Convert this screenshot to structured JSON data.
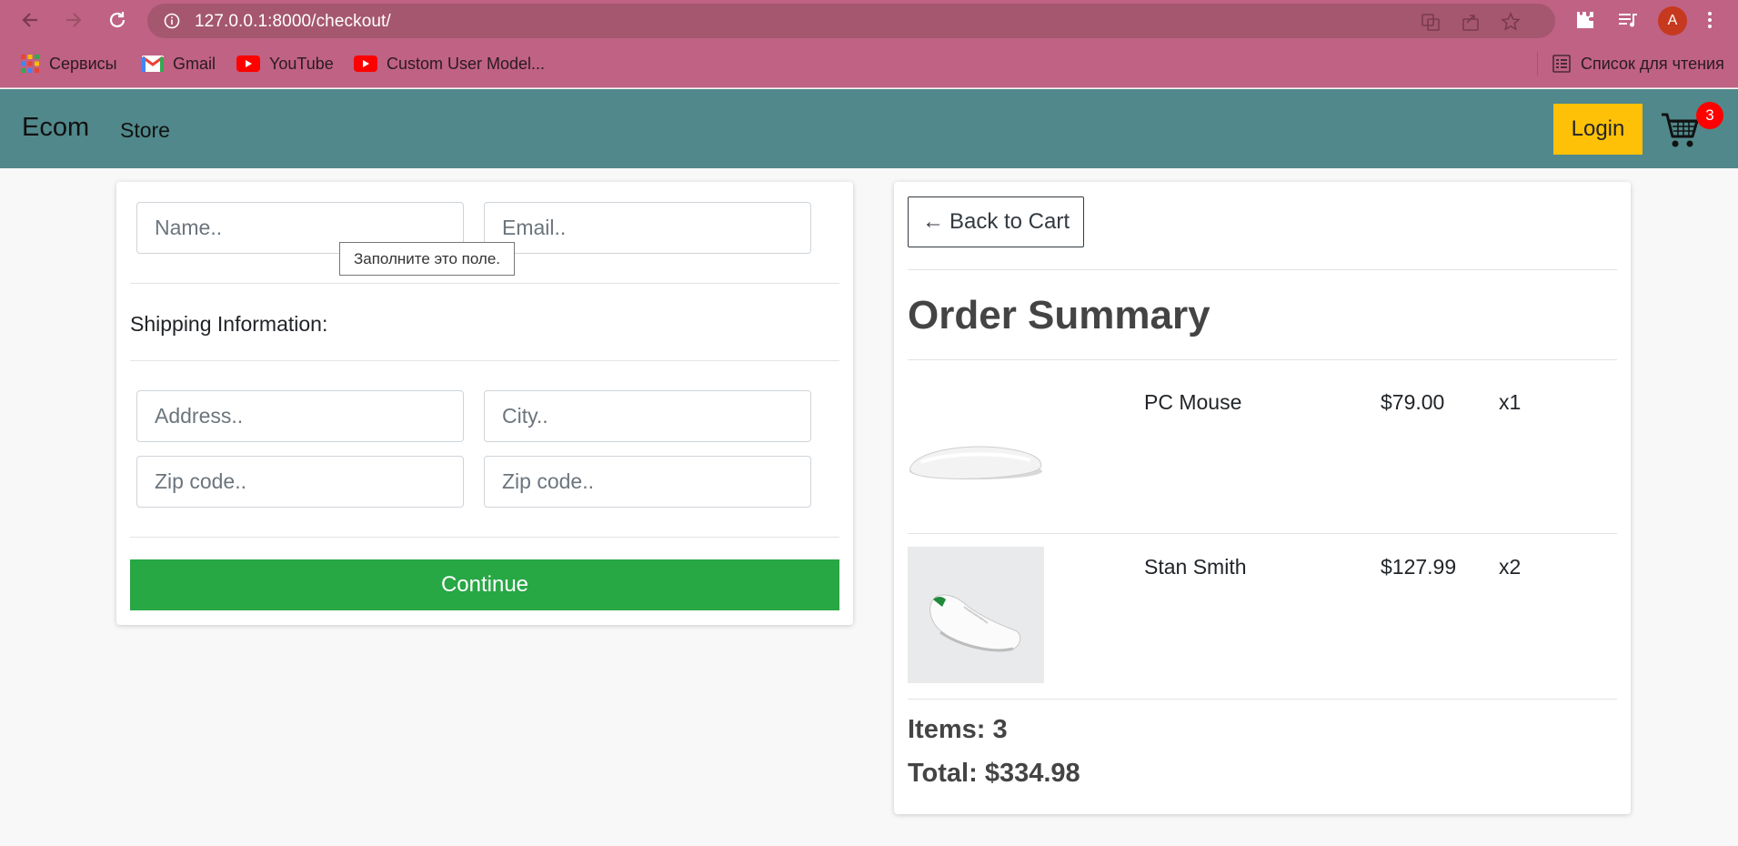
{
  "browser": {
    "url": "127.0.0.1:8000/checkout/",
    "avatar_letter": "A",
    "bookmarks": [
      {
        "label": "Сервисы",
        "icon": "apps-grid-icon"
      },
      {
        "label": "Gmail",
        "icon": "gmail-icon"
      },
      {
        "label": "YouTube",
        "icon": "youtube-icon"
      },
      {
        "label": "Custom User Model...",
        "icon": "youtube-icon"
      }
    ],
    "reading_list": "Список для чтения"
  },
  "site_nav": {
    "brand": "Ecom",
    "store": "Store",
    "login": "Login",
    "cart_count": "3"
  },
  "form": {
    "name_placeholder": "Name..",
    "email_placeholder": "Email..",
    "tooltip": "Заполните это поле.",
    "shipping_label": "Shipping Information:",
    "address_placeholder": "Address..",
    "city_placeholder": "City..",
    "zip_placeholder_1": "Zip code..",
    "zip_placeholder_2": "Zip code..",
    "continue": "Continue"
  },
  "summary": {
    "back_button": "Back to Cart",
    "back_arrow": "←",
    "title": "Order Summary",
    "items": [
      {
        "name": "PC Mouse",
        "price": "$79.00",
        "qty": "x1"
      },
      {
        "name": "Stan Smith",
        "price": "$127.99",
        "qty": "x2"
      }
    ],
    "items_total": "Items: 3",
    "total": "Total: $334.98"
  },
  "colors": {
    "chrome": "#bf6283",
    "navbar": "#51888b",
    "login": "#ffc107",
    "continue": "#28a745",
    "badge": "#ff0000"
  }
}
